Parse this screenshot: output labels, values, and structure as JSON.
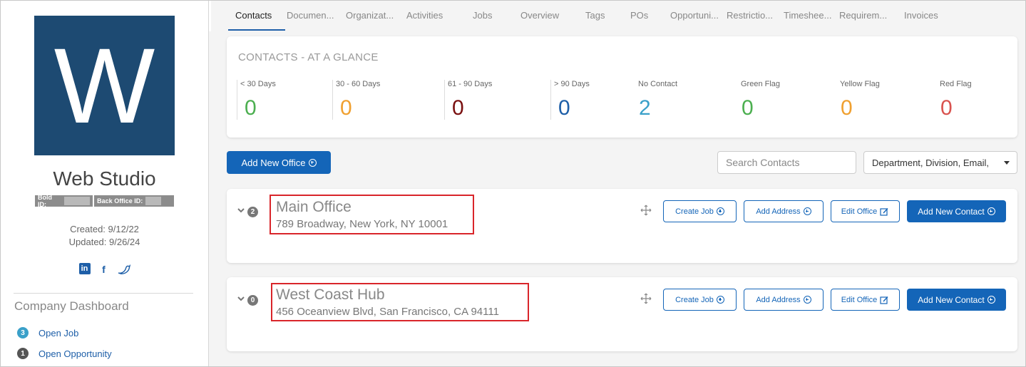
{
  "company": {
    "logo_letter": "W",
    "name": "Web Studio",
    "bold_id_label": "Bold ID:",
    "back_office_id_label": "Back Office ID:",
    "created": "Created: 9/12/22",
    "updated": "Updated: 9/26/24"
  },
  "social": {
    "linkedin": "in",
    "facebook": "f",
    "twitter": "🐦"
  },
  "dashboard": {
    "title": "Company Dashboard",
    "items": [
      {
        "count": "3",
        "label": "Open Job",
        "badge_color": "#3aa0c9"
      },
      {
        "count": "1",
        "label": "Open Opportunity",
        "badge_color": "#555555"
      }
    ]
  },
  "tabs": [
    "Contacts",
    "Documen...",
    "Organizat...",
    "Activities",
    "Jobs",
    "Overview",
    "Tags",
    "POs",
    "Opportuni...",
    "Restrictio...",
    "Timeshee...",
    "Requirem...",
    "Invoices"
  ],
  "active_tab": "Contacts",
  "glance": {
    "title": "CONTACTS - AT A GLANCE",
    "stats": [
      {
        "label": "< 30 Days",
        "value": "0",
        "color": "#4caf50"
      },
      {
        "label": "30 - 60 Days",
        "value": "0",
        "color": "#f0a030"
      },
      {
        "label": "61 - 90 Days",
        "value": "0",
        "color": "#7a1010"
      },
      {
        "label": "> 90 Days",
        "value": "0",
        "color": "#1e5fa8"
      },
      {
        "label": "No Contact",
        "value": "2",
        "color": "#3aa0c9"
      },
      {
        "label": "Green Flag",
        "value": "0",
        "color": "#4caf50"
      },
      {
        "label": "Yellow Flag",
        "value": "0",
        "color": "#f0a030"
      },
      {
        "label": "Red Flag",
        "value": "0",
        "color": "#d9534f"
      }
    ]
  },
  "actions": {
    "add_office": "Add New Office",
    "search_placeholder": "Search Contacts",
    "filter_value": "Department, Division, Email,"
  },
  "offices": [
    {
      "count": "2",
      "name": "Main Office",
      "address": "789 Broadway, New York, NY 10001",
      "create_job": "Create Job",
      "add_address": "Add Address",
      "edit_office": "Edit Office",
      "add_contact": "Add New Contact"
    },
    {
      "count": "0",
      "name": "West Coast Hub",
      "address": "456 Oceanview Blvd, San Francisco, CA 94111",
      "create_job": "Create Job",
      "add_address": "Add Address",
      "edit_office": "Edit Office",
      "add_contact": "Add New Contact"
    }
  ]
}
